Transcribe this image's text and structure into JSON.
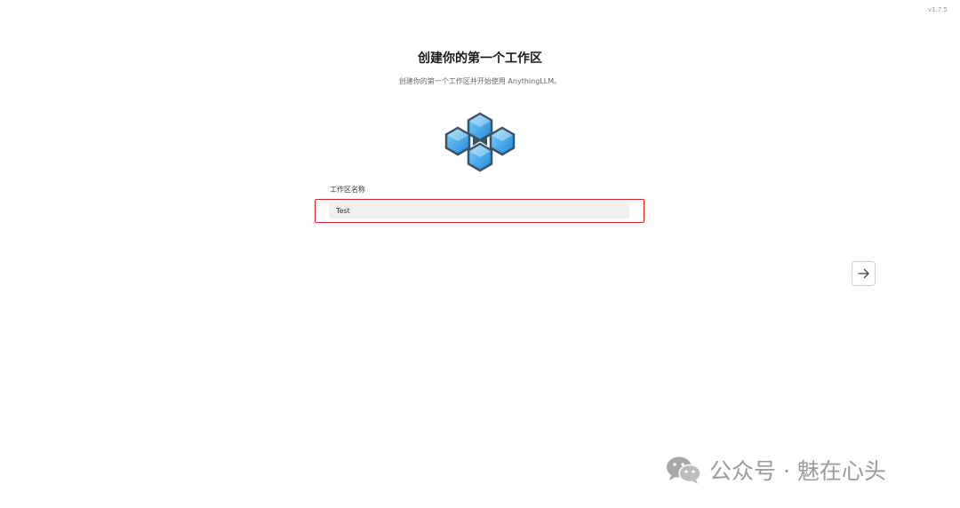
{
  "app": {
    "version": "v1.7.5"
  },
  "onboarding": {
    "title": "创建你的第一个工作区",
    "subtitle": "创建你的第一个工作区并开始使用 AnythingLLM。"
  },
  "workspace_form": {
    "label": "工作区名称",
    "value": "Test"
  },
  "navigation": {
    "next_icon": "arrow-right-icon"
  },
  "colors": {
    "highlight": "#e02424",
    "logo_blue": "#3aa6e8",
    "logo_outline": "#3a5366"
  },
  "watermark": {
    "text": "公众号 · 魅在心头"
  }
}
